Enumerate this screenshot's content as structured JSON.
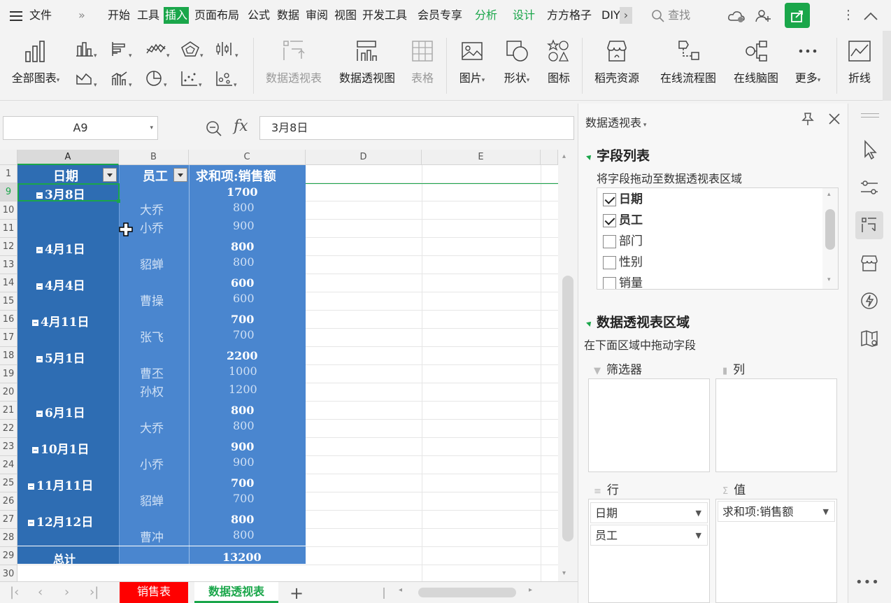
{
  "menu": {
    "file": "文件",
    "tabs": [
      "开始",
      "工具",
      "插入",
      "页面布局",
      "公式",
      "数据",
      "审阅",
      "视图",
      "开发工具",
      "会员专享",
      "分析",
      "设计",
      "方方格子",
      "DIY"
    ],
    "search": "查找"
  },
  "ribbon": {
    "all_charts": "全部图表",
    "pivot_table": "数据透视表",
    "pivot_chart": "数据透视图",
    "table": "表格",
    "picture": "图片",
    "shape": "形状",
    "icon": "图标",
    "docer": "稻壳资源",
    "flowchart": "在线流程图",
    "mindmap": "在线脑图",
    "more": "更多",
    "sparkline": "折线"
  },
  "formula_bar": {
    "cell_ref": "A9",
    "fx": "fx",
    "content": "3月8日"
  },
  "sheet": {
    "columns": [
      "A",
      "B",
      "C",
      "D",
      "E"
    ],
    "rows": [
      "1",
      "9",
      "10",
      "11",
      "12",
      "13",
      "14",
      "15",
      "16",
      "17",
      "18",
      "19",
      "20",
      "21",
      "22",
      "23",
      "24",
      "25",
      "26",
      "27",
      "28",
      "29",
      "30"
    ],
    "header": {
      "date": "日期",
      "employee": "员工",
      "sum": "求和项:销售额"
    },
    "groups": [
      {
        "date": "3月8日",
        "total": "1700",
        "items": [
          [
            "大乔",
            "800"
          ],
          [
            "小乔",
            "900"
          ]
        ]
      },
      {
        "date": "4月1日",
        "total": "800",
        "items": [
          [
            "貂蝉",
            "800"
          ]
        ]
      },
      {
        "date": "4月4日",
        "total": "600",
        "items": [
          [
            "曹操",
            "600"
          ]
        ]
      },
      {
        "date": "4月11日",
        "total": "700",
        "items": [
          [
            "张飞",
            "700"
          ]
        ]
      },
      {
        "date": "5月1日",
        "total": "2200",
        "items": [
          [
            "曹丕",
            "1000"
          ],
          [
            "孙权",
            "1200"
          ]
        ]
      },
      {
        "date": "6月1日",
        "total": "800",
        "items": [
          [
            "大乔",
            "800"
          ]
        ]
      },
      {
        "date": "10月1日",
        "total": "900",
        "items": [
          [
            "小乔",
            "900"
          ]
        ]
      },
      {
        "date": "11月11日",
        "total": "700",
        "items": [
          [
            "貂蝉",
            "700"
          ]
        ]
      },
      {
        "date": "12月12日",
        "total": "800",
        "items": [
          [
            "曹冲",
            "800"
          ]
        ]
      }
    ],
    "grand_total_label": "总计",
    "grand_total": "13200"
  },
  "sheet_tabs": [
    "销售表",
    "数据透视表"
  ],
  "panel": {
    "title": "数据透视表",
    "field_list_title": "字段列表",
    "field_list_hint": "将字段拖动至数据透视表区域",
    "fields": [
      {
        "name": "日期",
        "checked": true
      },
      {
        "name": "员工",
        "checked": true
      },
      {
        "name": "部门",
        "checked": false
      },
      {
        "name": "性别",
        "checked": false
      },
      {
        "name": "销量",
        "checked": false
      }
    ],
    "areas_title": "数据透视表区域",
    "areas_hint": "在下面区域中拖动字段",
    "filter_label": "筛选器",
    "column_label": "列",
    "row_label": "行",
    "value_label": "值",
    "row_fields": [
      "日期",
      "员工"
    ],
    "value_fields": [
      "求和项:销售额"
    ]
  },
  "colors": {
    "accent": "#1aa64a",
    "pivot_dark": "#2e6db3",
    "pivot_light": "#4a86cf",
    "red_tab": "#ff0000"
  }
}
